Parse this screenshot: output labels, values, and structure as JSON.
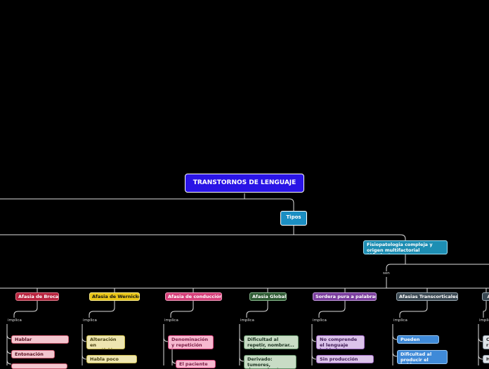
{
  "root": {
    "title": "TRANSTORNOS DE LENGUAJE"
  },
  "tipos": {
    "label": "Tipos"
  },
  "fisio": {
    "label": "Fisiopatologia compleja y origen multifactorial \"Afasias\"",
    "link": "son"
  },
  "link_implica": "implica",
  "categories": [
    {
      "label": "Afasia de Broca",
      "children": [
        "Hablar pausadamente",
        "Entonación baja"
      ]
    },
    {
      "label": "Afasia de Wernicke",
      "children": [
        "Alteración en repetición",
        "Habla poco fluente"
      ]
    },
    {
      "label": "Afasia de conducción",
      "children": [
        "Denominación y repetición",
        "El paciente"
      ]
    },
    {
      "label": "Afasia Global",
      "children": [
        "Dificultad al repetir, nombrar... el habla",
        "Derivado: tumores, demencia etc"
      ]
    },
    {
      "label": "Sordera pura a palabras",
      "children": [
        "No comprende el lenguaje hablado",
        "Sin producción verbal"
      ]
    },
    {
      "label": "Afasias Transcorticales",
      "children": [
        "Pueden repetir",
        "Dificultad al producir el hablas"
      ]
    },
    {
      "label": "A",
      "children": [
        "C r",
        "H"
      ]
    }
  ],
  "colors": {
    "broca": "#b8243f",
    "wernicke": "#e8c418",
    "conduccion": "#d6407a",
    "global": "#2f5b34",
    "sordera": "#7b3e9e",
    "transcorticales": "#3a4852"
  }
}
